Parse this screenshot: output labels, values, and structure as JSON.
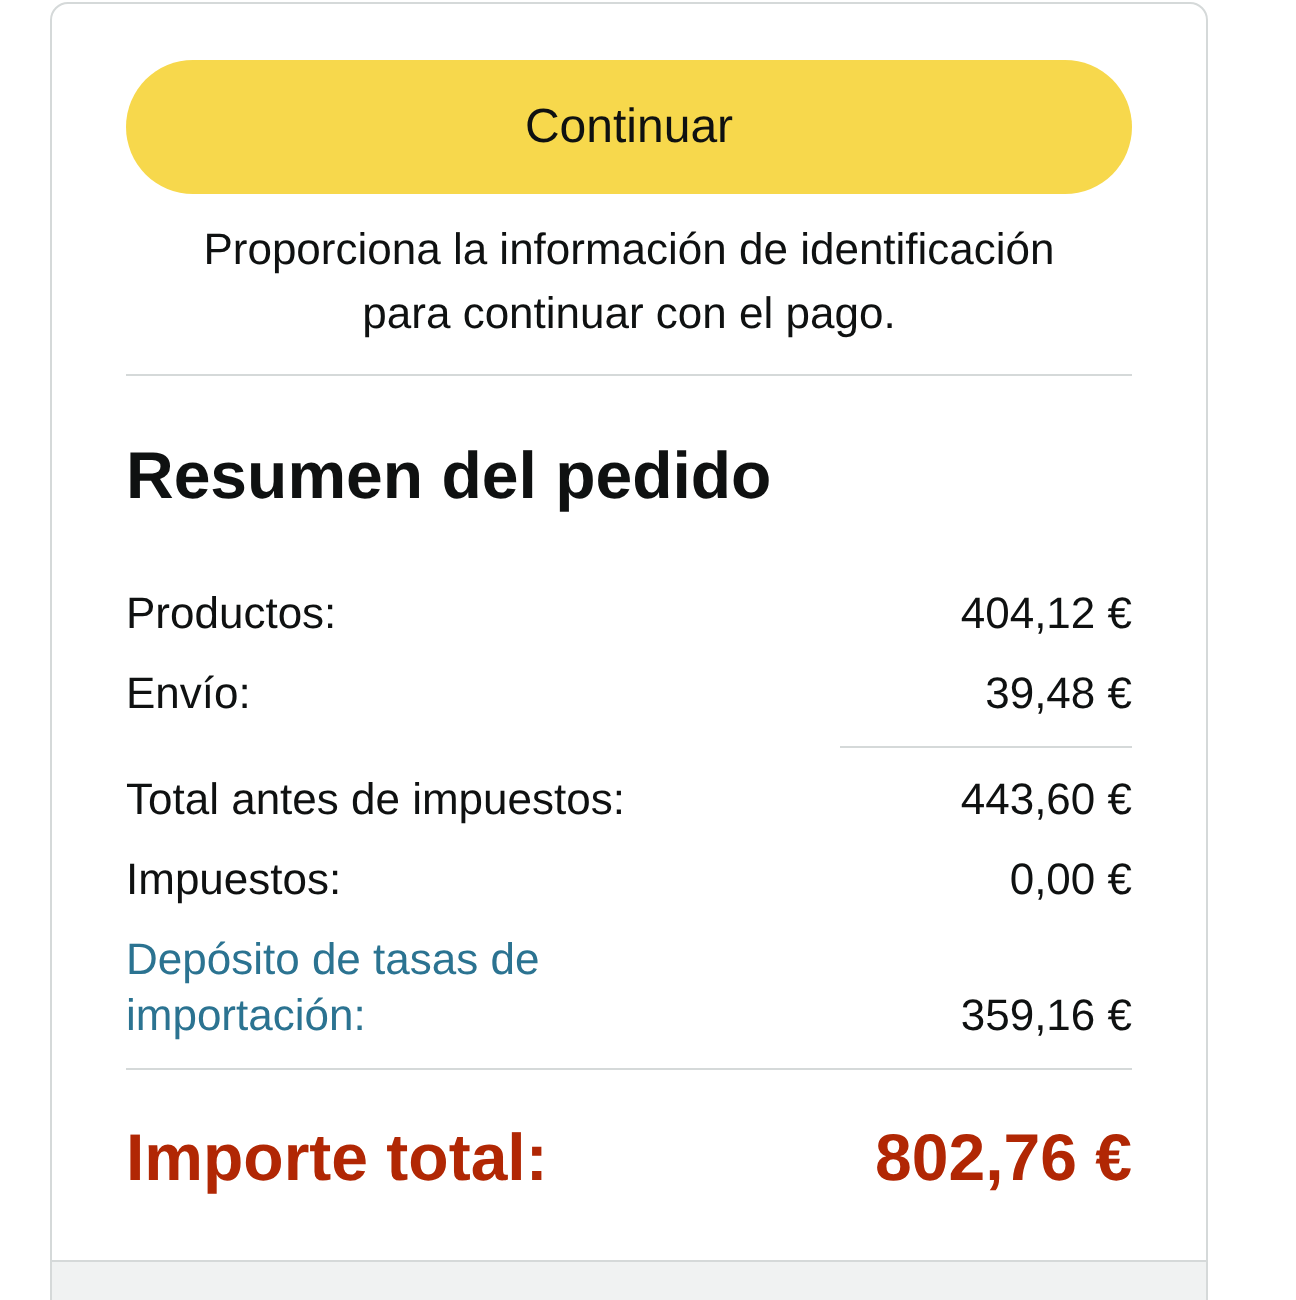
{
  "continue_button": {
    "label": "Continuar"
  },
  "notice": "Proporciona la información de identificación para continuar con el pago.",
  "order_summary": {
    "title": "Resumen del pedido",
    "rows": [
      {
        "kind": "plain",
        "label": "Productos:",
        "value": "404,12 €"
      },
      {
        "kind": "plain",
        "label": "Envío:",
        "value": "39,48 €"
      },
      {
        "kind": "subtotal",
        "label": "Total antes de impuestos:",
        "value": "443,60 €"
      },
      {
        "kind": "plain",
        "label": "Impuestos:",
        "value": "0,00 €"
      },
      {
        "kind": "link",
        "label": "Depósito de tasas de importación:",
        "value": "359,16 €"
      }
    ],
    "total": {
      "label": "Importe total:",
      "value": "802,76 €"
    }
  }
}
